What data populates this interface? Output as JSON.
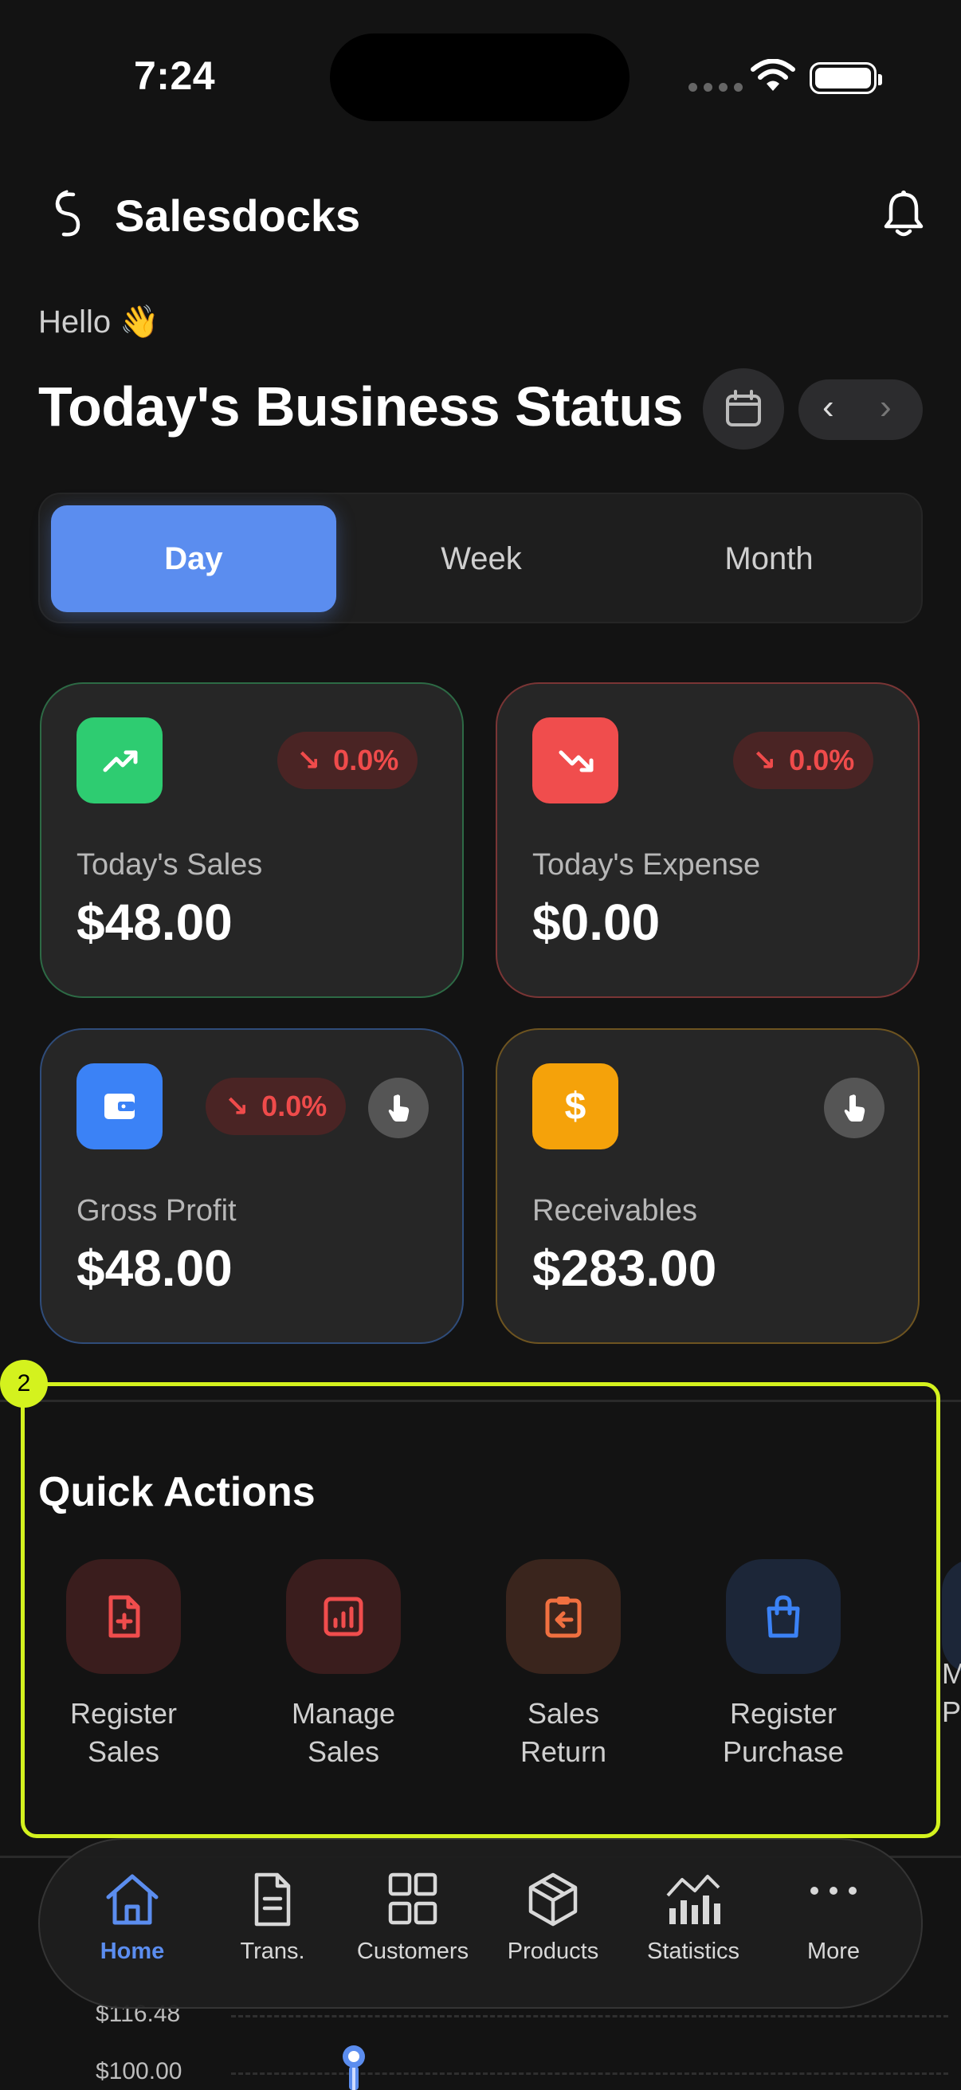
{
  "status_bar": {
    "time": "7:24"
  },
  "header": {
    "brand": "Salesdocks"
  },
  "greeting": "Hello 👋",
  "page_title": "Today's Business Status",
  "date_nav": {
    "prev": "‹",
    "next": "›"
  },
  "period_tabs": [
    {
      "label": "Day",
      "active": true
    },
    {
      "label": "Week",
      "active": false
    },
    {
      "label": "Month",
      "active": false
    }
  ],
  "cards": [
    {
      "label": "Today's Sales",
      "value": "$48.00",
      "change": "0.0%",
      "icon": "trending-up-icon",
      "color": "#2ecc71"
    },
    {
      "label": "Today's Expense",
      "value": "$0.00",
      "change": "0.0%",
      "icon": "trending-down-icon",
      "color": "#f04d4d"
    },
    {
      "label": "Gross Profit",
      "value": "$48.00",
      "change": "0.0%",
      "icon": "wallet-icon",
      "color": "#3b82f6"
    },
    {
      "label": "Receivables",
      "value": "$283.00",
      "icon": "dollar-icon",
      "color": "#f5a20a"
    }
  ],
  "annotation_number": "2",
  "quick_actions": {
    "title": "Quick Actions",
    "items": [
      {
        "label": "Register\nSales",
        "icon": "file-plus-icon"
      },
      {
        "label": "Manage\nSales",
        "icon": "report-chart-icon"
      },
      {
        "label": "Sales\nReturn",
        "icon": "clipboard-return-icon"
      },
      {
        "label": "Register\nPurchase",
        "icon": "shopping-bag-icon"
      }
    ],
    "peek": "M\nP"
  },
  "chart_peek": {
    "y_ticks": [
      "$116.48",
      "$100.00"
    ]
  },
  "tab_bar": [
    {
      "label": "Home",
      "icon": "home-icon",
      "active": true
    },
    {
      "label": "Trans.",
      "icon": "document-icon",
      "active": false
    },
    {
      "label": "Customers",
      "icon": "grid-icon",
      "active": false
    },
    {
      "label": "Products",
      "icon": "box-icon",
      "active": false
    },
    {
      "label": "Statistics",
      "icon": "stats-icon",
      "active": false
    },
    {
      "label": "More",
      "icon": "more-icon",
      "active": false
    }
  ],
  "colors": {
    "accent": "#5b8def",
    "highlight": "#d4f21e",
    "negative": "#ef4b4b"
  }
}
